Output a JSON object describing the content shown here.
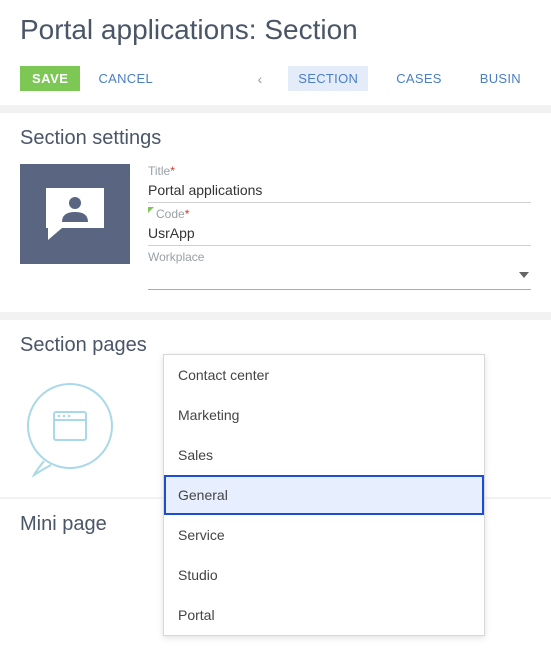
{
  "header": {
    "title": "Portal applications: Section"
  },
  "toolbar": {
    "save_label": "SAVE",
    "cancel_label": "CANCEL",
    "tabs": [
      {
        "label": "SECTION",
        "active": true
      },
      {
        "label": "CASES",
        "active": false
      },
      {
        "label": "BUSIN",
        "active": false
      }
    ]
  },
  "section_settings": {
    "heading": "Section settings",
    "fields": {
      "title": {
        "label": "Title",
        "required": true,
        "value": "Portal applications"
      },
      "code": {
        "label": "Code",
        "required": true,
        "value": "UsrApp"
      },
      "workplace": {
        "label": "Workplace",
        "value": "",
        "options": [
          "Contact center",
          "Marketing",
          "Sales",
          "General",
          "Service",
          "Studio",
          "Portal"
        ],
        "highlighted": "General"
      }
    }
  },
  "section_pages": {
    "heading": "Section pages"
  },
  "mini_page": {
    "heading": "Mini page"
  }
}
